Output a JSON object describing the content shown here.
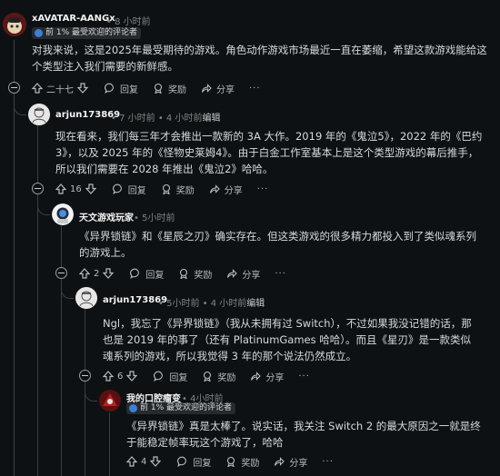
{
  "comments": [
    {
      "username": "xAVATAR-AANGx",
      "time": "8 小时前",
      "flair": "前 1% 最受欢迎的评论者",
      "text": "对我来说，这是2025年最受期待的游戏。角色动作游戏市场最近一直在萎缩，希望这款游戏能给这个类型注入我们需要的新鲜感。",
      "votes": "二十七",
      "reply": "回复",
      "award": "奖励",
      "share": "分享"
    },
    {
      "username": "arjun173869",
      "time": "7 小时前",
      "edited": "4 小时前",
      "edited_label": "编辑",
      "text": "现在看来，我们每三年才会推出一款新的 3A 大作。2019 年的《鬼泣5》，2022 年的《巴约3》，以及 2025 年的《怪物史莱姆4》。由于白金工作室基本上是这个类型游戏的幕后推手，所以我们需要在 2028 年推出《鬼泣2》哈哈。",
      "votes": "16",
      "reply": "回复",
      "award": "奖励",
      "share": "分享"
    },
    {
      "username": "天文游戏玩家",
      "time": "5小时前",
      "text": "《异界锁链》和《星辰之刃》确实存在。但这类游戏的很多精力都投入到了类似魂系列的游戏上。",
      "votes": "2",
      "reply": "回复",
      "award": "奖励",
      "share": "分享"
    },
    {
      "username": "arjun173869",
      "time": "5小时前",
      "edited": "4 小时前",
      "edited_label": "编辑",
      "text": "Ngl，我忘了《异界锁链》（我从未拥有过 Switch），不过如果我没记错的话，那也是 2019 年的事了（还有 PlatinumGames 哈哈）。而且《星刃》是一款类似魂系列的游戏，所以我觉得 3 年的那个说法仍然成立。",
      "votes": "6",
      "reply": "回复",
      "award": "奖励",
      "share": "分享"
    },
    {
      "username": "我的口腔瘤变",
      "time": "4小时前",
      "flair": "前 1% 最受欢迎的评论者",
      "text": "《异界锁链》真是太棒了。说实话，我关注 Switch 2 的最大原因之一就是终于能稳定帧率玩这个游戏了，哈哈",
      "votes": "4",
      "reply": "回复",
      "award": "奖励",
      "share": "分享"
    }
  ],
  "more_glyph": "···",
  "dot": "•",
  "colors": {
    "background": "#0e1113",
    "flair_badge": "#3c7fd6",
    "thread_line": "#3a3f43"
  }
}
